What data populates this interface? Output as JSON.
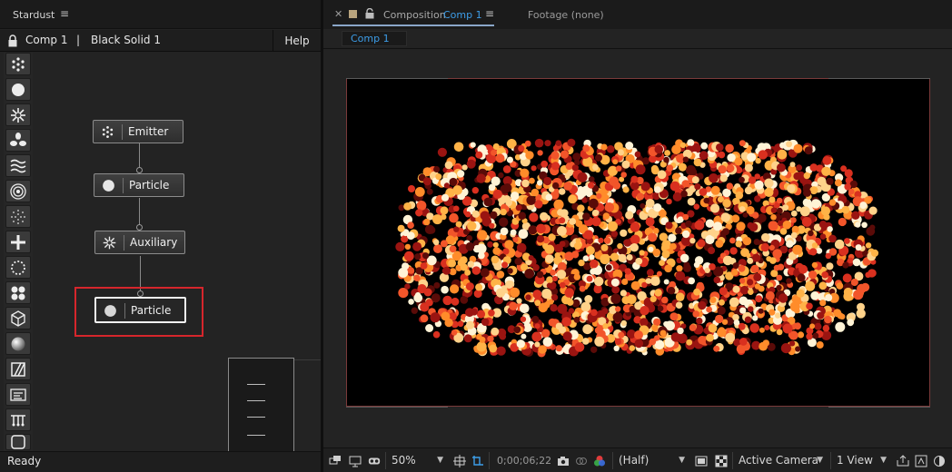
{
  "left_panel": {
    "tab_title": "Stardust",
    "menu_icon": "hamburger-menu-icon",
    "header": {
      "comp": "Comp 1",
      "separator": "|",
      "layer": "Black Solid 1",
      "help": "Help"
    },
    "toolbar": [
      "emitter-icon",
      "particle-icon",
      "auxiliary-icon",
      "fan-force-icon",
      "wave-icon",
      "rings-icon",
      "sparkle-icon",
      "plus-icon",
      "dotted-circle-icon",
      "cluster-icon",
      "cube-icon",
      "sphere-icon",
      "slash-box-icon",
      "list-icon",
      "hanging-lines-icon",
      "rounded-square-icon"
    ],
    "nodes": [
      {
        "label": "Emitter",
        "icon": "emitter-icon"
      },
      {
        "label": "Particle",
        "icon": "particle-icon"
      },
      {
        "label": "Auxiliary",
        "icon": "auxiliary-icon"
      },
      {
        "label": "Particle",
        "icon": "particle-icon"
      }
    ],
    "status": "Ready"
  },
  "comp_panel": {
    "tab_prefix": "Composition",
    "tab_comp": "Comp 1",
    "footage_tab": "Footage (none)",
    "sub_tab": "Comp 1",
    "controls": {
      "zoom": "50%",
      "timecode": "0;00;06;22",
      "resolution": "(Half)",
      "camera": "Active Camera",
      "views": "1 View"
    }
  },
  "colors": {
    "selection_highlight": "#d6262c",
    "accent_blue": "#3d9de8",
    "canvas_border": "#7a3a3a",
    "particle_palette": [
      "#fff3d6",
      "#ffd28a",
      "#ffb347",
      "#ff8c2a",
      "#f2552a",
      "#d9301f",
      "#9a1411",
      "#5a0b08"
    ]
  }
}
